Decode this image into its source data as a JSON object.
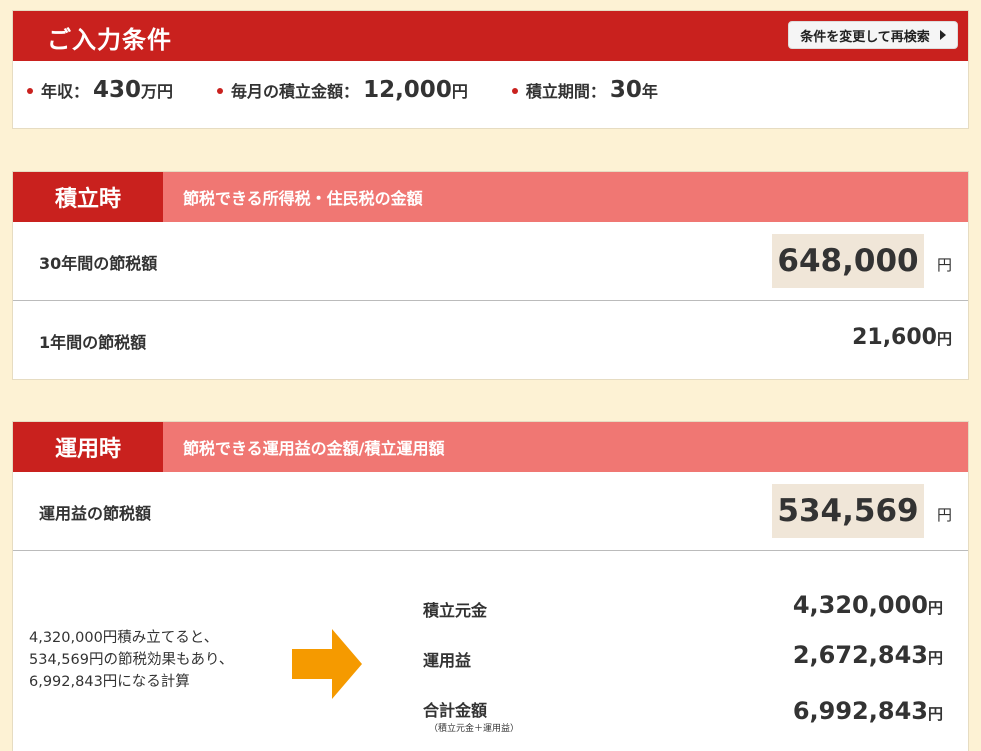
{
  "conditions": {
    "title": "ご入力条件",
    "change_button": "条件を変更して再検索",
    "items": [
      {
        "label": "年収：",
        "value": "430",
        "unit": "万円"
      },
      {
        "label": "毎月の積立金額：",
        "value": "12,000",
        "unit": "円"
      },
      {
        "label": "積立期間：",
        "value": "30",
        "unit": "年"
      }
    ]
  },
  "accumulation": {
    "tag": "積立時",
    "desc": "節税できる所得税・住民税の金額",
    "total_label": "30年間の節税額",
    "total_value": "648,000",
    "total_unit": "円",
    "annual_label": "1年間の節税額",
    "annual_value": "21,600",
    "annual_unit": "円"
  },
  "operation": {
    "tag": "運用時",
    "desc": "節税できる運用益の金額/積立運用額",
    "saving_label": "運用益の節税額",
    "saving_value": "534,569",
    "saving_unit": "円",
    "note": "4,320,000円積み立てると、534,569円の節税効果もあり、6,992,843円になる計算",
    "summary": [
      {
        "label": "積立元金",
        "sub": "",
        "value": "4,320,000",
        "unit": "円"
      },
      {
        "label": "運用益",
        "sub": "",
        "value": "2,672,843",
        "unit": "円"
      },
      {
        "label": "合計金額",
        "sub": "（積立元金＋運用益）",
        "value": "6,992,843",
        "unit": "円"
      }
    ]
  },
  "colors": {
    "primary_red": "#c9211e",
    "salmon": "#f07773",
    "value_box": "#f0e6d8",
    "background": "#fdf2d4",
    "arrow": "#f59a00"
  }
}
